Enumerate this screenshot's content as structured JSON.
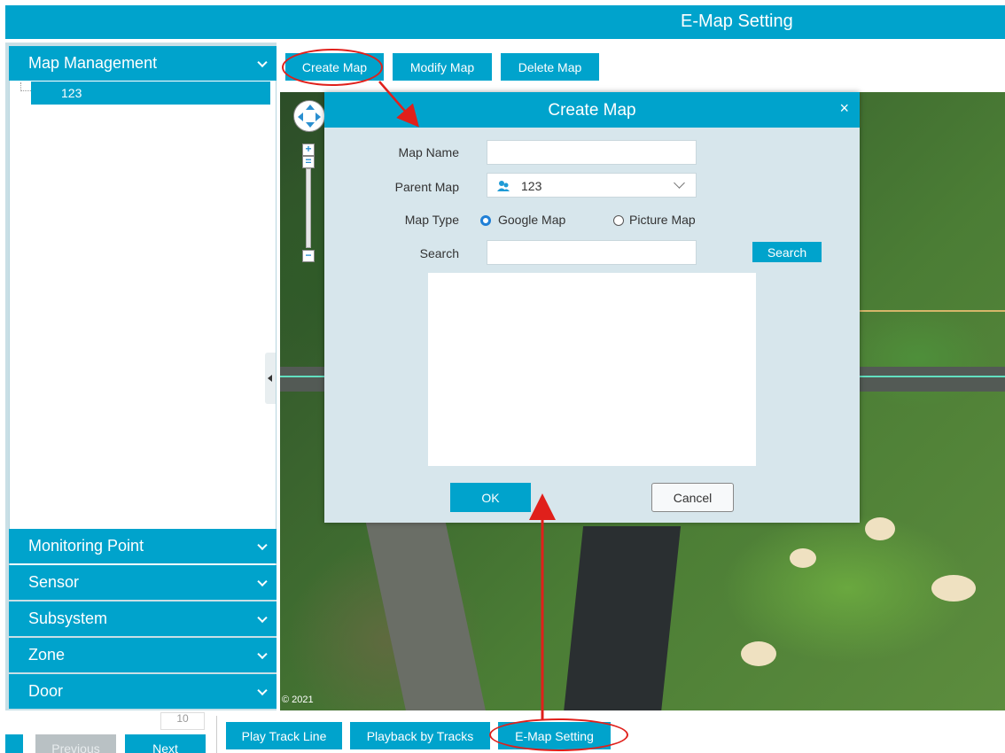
{
  "window": {
    "title": "E-Map Setting"
  },
  "sidebar": {
    "map_management": {
      "label": "Map Management",
      "tree_items": [
        "123"
      ]
    },
    "sections": [
      {
        "label": "Monitoring Point"
      },
      {
        "label": "Sensor"
      },
      {
        "label": "Subsystem"
      },
      {
        "label": "Zone"
      },
      {
        "label": "Door"
      }
    ]
  },
  "toolbar": {
    "create_map": "Create Map",
    "modify_map": "Modify Map",
    "delete_map": "Delete Map"
  },
  "map": {
    "copyright": "© 2021"
  },
  "dialog": {
    "title": "Create Map",
    "close": "×",
    "fields": {
      "map_name": {
        "label": "Map Name",
        "value": ""
      },
      "parent_map": {
        "label": "Parent Map",
        "value": "123"
      },
      "map_type": {
        "label": "Map Type",
        "options": [
          "Google Map",
          "Picture Map"
        ],
        "selected": "Google Map"
      },
      "search": {
        "label": "Search",
        "value": "",
        "button": "Search"
      }
    },
    "ok": "OK",
    "cancel": "Cancel"
  },
  "bottom": {
    "page_size": "10",
    "previous": "Previous",
    "next": "Next",
    "play_track_line": "Play Track Line",
    "playback_by_tracks": "Playback by Tracks",
    "emap_setting": "E-Map Setting"
  },
  "colors": {
    "accent": "#00a3cc",
    "annotation": "#e0201b",
    "panel": "#d7e6ec"
  }
}
